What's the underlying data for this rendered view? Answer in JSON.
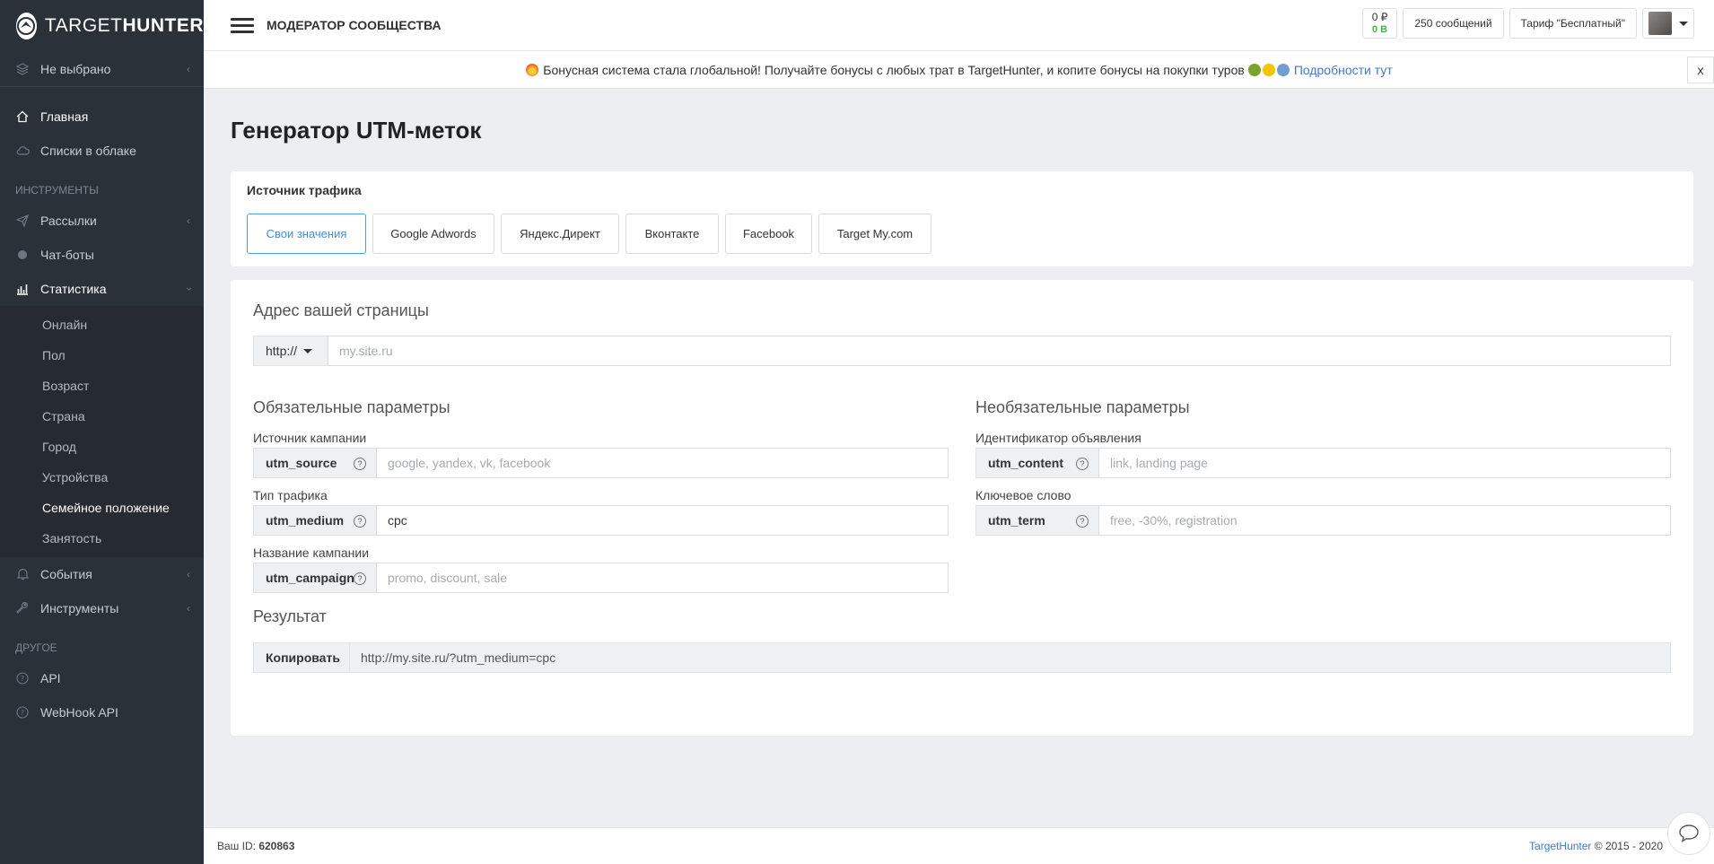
{
  "brand": {
    "name_light": "TARGET",
    "name_bold": "HUNTER"
  },
  "sidebar": {
    "selector": "Не выбрано",
    "items_top": [
      {
        "label": "Главная",
        "icon": "home-icon"
      },
      {
        "label": "Списки в облаке",
        "icon": "cloud-icon"
      }
    ],
    "head_tools": "ИНСТРУМЕНТЫ",
    "items_tools": [
      {
        "label": "Рассылки",
        "icon": "paper-plane-icon"
      },
      {
        "label": "Чат-боты",
        "icon": "bot-icon"
      },
      {
        "label": "Статистика",
        "icon": "bar-chart-icon"
      }
    ],
    "stats_sub": [
      "Онлайн",
      "Пол",
      "Возраст",
      "Страна",
      "Город",
      "Устройства",
      "Семейное положение",
      "Занятость"
    ],
    "items_more": [
      {
        "label": "События",
        "icon": "bell-icon"
      },
      {
        "label": "Инструменты",
        "icon": "wrench-icon"
      }
    ],
    "head_other": "ДРУГОЕ",
    "items_other": [
      {
        "label": "API",
        "icon": "question-icon"
      },
      {
        "label": "WebHook API",
        "icon": "question-icon"
      }
    ]
  },
  "topbar": {
    "title": "МОДЕРАТОР СООБЩЕСТВА",
    "balance_rub": "0 ₽",
    "balance_bonus": "0 B",
    "messages": "250 сообщений",
    "tariff": "Тариф \"Бесплатный\""
  },
  "notice": {
    "text": "Бонусная система стала глобальной! Получайте бонусы с любых трат в TargetHunter, и копите бонусы на покупки туров",
    "link": "Подробности тут",
    "close": "x"
  },
  "page": {
    "title": "Генератор UTM-меток",
    "source_label": "Источник трафика",
    "source_tabs": [
      "Свои значения",
      "Google Adwords",
      "Яндекс.Директ",
      "Вконтакте",
      "Facebook",
      "Target My.com"
    ],
    "address_title": "Адрес вашей страницы",
    "protocol": "http://",
    "url_placeholder": "my.site.ru",
    "required_title": "Обязательные параметры",
    "optional_title": "Необязательные параметры",
    "required": [
      {
        "label": "Источник кампании",
        "key": "utm_source",
        "value": "",
        "placeholder": "google, yandex, vk, facebook"
      },
      {
        "label": "Тип трафика",
        "key": "utm_medium",
        "value": "cpc",
        "placeholder": ""
      },
      {
        "label": "Название кампании",
        "key": "utm_campaign",
        "value": "",
        "placeholder": "promo, discount, sale"
      }
    ],
    "optional": [
      {
        "label": "Идентификатор объявления",
        "key": "utm_content",
        "value": "",
        "placeholder": "link, landing page"
      },
      {
        "label": "Ключевое слово",
        "key": "utm_term",
        "value": "",
        "placeholder": "free, -30%, registration"
      }
    ],
    "result_title": "Результат",
    "copy_label": "Копировать",
    "result_value": "http://my.site.ru/?utm_medium=cpc"
  },
  "footer": {
    "id_label": "Ваш ID:",
    "id_value": "620863",
    "brand": "TargetHunter",
    "years": "© 2015 - 2020"
  },
  "colors": {
    "sidebar_bg": "#2b3139",
    "accent": "#4a9fe9",
    "link": "#3d79d6",
    "bonus": "#3cb54a"
  }
}
